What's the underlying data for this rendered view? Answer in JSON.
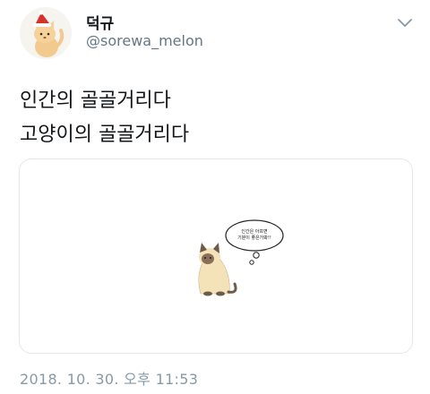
{
  "tweet": {
    "display_name": "덕규",
    "handle": "@sorewa_melon",
    "text_lines": [
      "인간의 골골거리다",
      "고양이의 골골거리다"
    ],
    "timestamp": "2018. 10. 30. 오후 11:53",
    "more_icon": "chevron-down-icon"
  },
  "media": {
    "bubble_lines": [
      "인간은 아프면",
      "기분이 좋은가봐!!"
    ]
  },
  "colors": {
    "text": "#14171a",
    "secondary": "#657786",
    "timestamp": "#8899a6",
    "border": "#e1e8ed"
  }
}
